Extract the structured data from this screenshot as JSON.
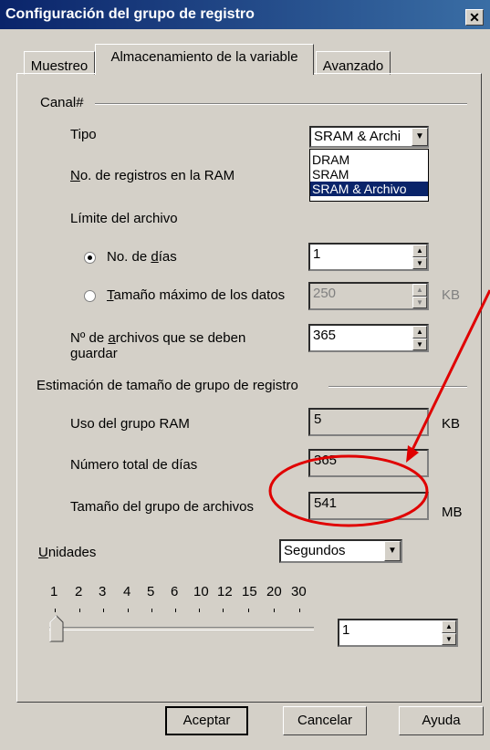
{
  "window": {
    "title": "Configuración del grupo de registro",
    "close_symbol": "✕"
  },
  "tabs": [
    {
      "label": "Muestreo"
    },
    {
      "label": "Almacenamiento de la variable",
      "active": true
    },
    {
      "label": "Avanzado"
    }
  ],
  "canal": {
    "group_label": "Canal#",
    "tipo_label": "Tipo",
    "tipo_value": "SRAM & Archi",
    "tipo_options": [
      "DRAM",
      "SRAM",
      "SRAM & Archivo"
    ],
    "tipo_selected": "SRAM & Archivo",
    "registros_label_pre": "N",
    "registros_label_post": "o. de registros en la RAM",
    "limite_label": "Límite del archivo",
    "dias_radio_pre": "No. de ",
    "dias_radio_u": "d",
    "dias_radio_post": "ías",
    "dias_value": "1",
    "tam_radio_u": "T",
    "tam_radio_post": "amaño máximo de los datos",
    "tam_value": "250",
    "tam_unit": "KB",
    "archivos_label_pre": "Nº de ",
    "archivos_label_u": "a",
    "archivos_label_post": "rchivos que se deben",
    "archivos_label_line2": "guardar",
    "archivos_value": "365"
  },
  "estimacion": {
    "group_label": "Estimación de tamaño de grupo de registro",
    "ram_label": "Uso del grupo RAM",
    "ram_value": "5",
    "ram_unit": "KB",
    "dias_label": "Número total de días",
    "dias_value": "365",
    "archivos_label": "Tamaño del grupo de archivos",
    "archivos_value": "541",
    "archivos_unit": "MB"
  },
  "unidades": {
    "label_u": "U",
    "label_post": "nidades",
    "value": "Segundos",
    "slider_ticks": [
      "1",
      "2",
      "3",
      "4",
      "5",
      "6",
      "10",
      "12",
      "15",
      "20",
      "30"
    ],
    "slider_value": "1",
    "spin_value": "1"
  },
  "buttons": {
    "ok": "Aceptar",
    "cancel": "Cancelar",
    "help": "Ayuda"
  },
  "annotation": {
    "color": "#e00000"
  }
}
